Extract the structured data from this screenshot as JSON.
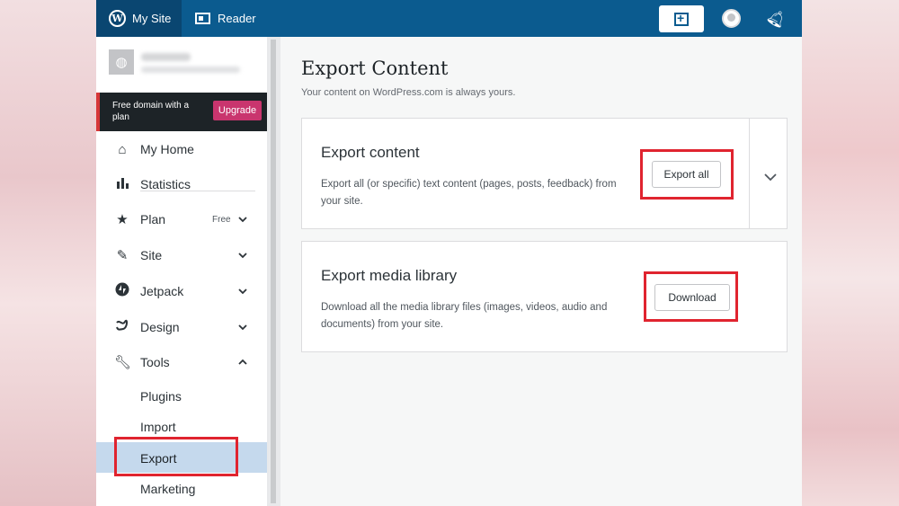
{
  "masterbar": {
    "my_site": "My Site",
    "reader": "Reader"
  },
  "promo": {
    "text": "Free domain with a plan",
    "button": "Upgrade"
  },
  "sidebar": {
    "items": [
      {
        "label": "My Home",
        "icon": "home-icon"
      },
      {
        "label": "Statistics",
        "icon": "bar-chart-icon"
      },
      {
        "label": "Plan",
        "icon": "star-icon",
        "badge": "Free"
      },
      {
        "label": "Site",
        "icon": "pencil-icon"
      },
      {
        "label": "Jetpack",
        "icon": "jetpack-icon"
      },
      {
        "label": "Design",
        "icon": "design-icon"
      },
      {
        "label": "Tools",
        "icon": "wrench-icon"
      }
    ],
    "tools_sub": [
      "Plugins",
      "Import",
      "Export",
      "Marketing"
    ]
  },
  "main": {
    "title": "Export Content",
    "subtitle": "Your content on WordPress.com is always yours.",
    "cards": [
      {
        "title": "Export content",
        "description": "Export all (or specific) text content (pages, posts, feedback) from your site.",
        "button": "Export all"
      },
      {
        "title": "Export media library",
        "description": "Download all the media library files (images, videos, audio and documents) from your site.",
        "button": "Download"
      }
    ]
  },
  "colors": {
    "masterbar": "#0b5b8f",
    "highlight": "#e0242f",
    "upgrade": "#c9356e",
    "active_item": "#c5d9ed"
  }
}
